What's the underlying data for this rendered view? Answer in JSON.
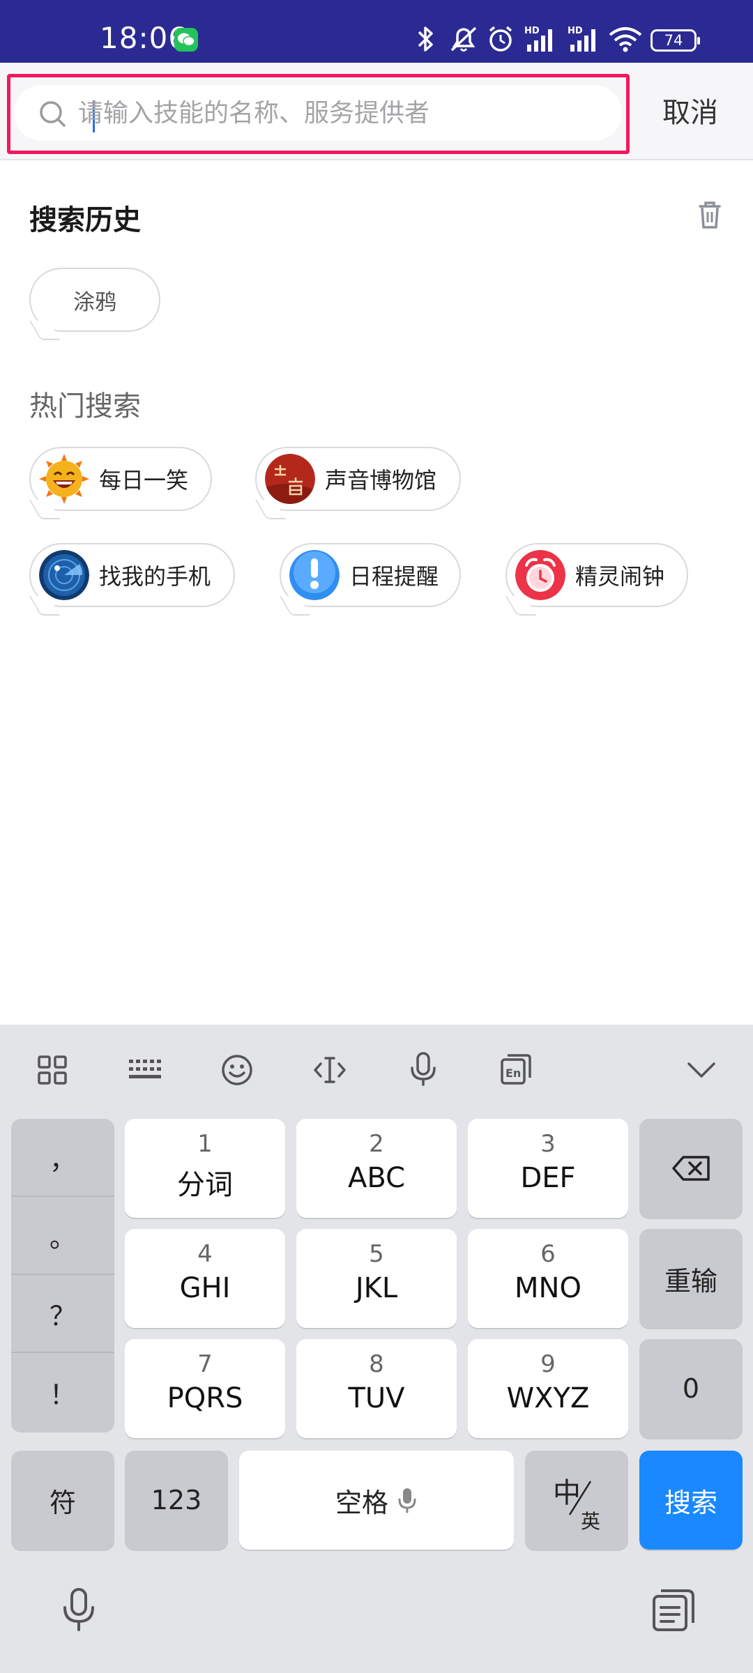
{
  "status_bar": {
    "time": "18:06",
    "battery": "74",
    "icons": [
      "wechat-icon",
      "bluetooth-icon",
      "mute-icon",
      "alarm-icon",
      "signal-hd-icon",
      "signal-hd-icon",
      "wifi-icon",
      "battery-icon"
    ]
  },
  "search": {
    "placeholder": "请输入技能的名称、服务提供者",
    "value": "",
    "cancel_label": "取消",
    "highlight_color": "#f0195f"
  },
  "history": {
    "title": "搜索历史",
    "items": [
      "涂鸦"
    ]
  },
  "hot": {
    "title": "热门搜索",
    "items": [
      {
        "label": "每日一笑",
        "icon": "laughing-sun-icon"
      },
      {
        "label": "声音博物馆",
        "icon": "sound-museum-icon"
      },
      {
        "label": "找我的手机",
        "icon": "radar-icon"
      },
      {
        "label": "日程提醒",
        "icon": "exclamation-icon"
      },
      {
        "label": "精灵闹钟",
        "icon": "alarm-clock-icon"
      }
    ]
  },
  "keyboard": {
    "toolbar": [
      "grid-icon",
      "keyboard-icon",
      "emoji-icon",
      "cursor-icon",
      "mic-icon",
      "translate-icon",
      "collapse-icon"
    ],
    "punctuation": [
      "，",
      "。",
      "？",
      "！"
    ],
    "keys": [
      {
        "num": "1",
        "letters": "分词"
      },
      {
        "num": "2",
        "letters": "ABC"
      },
      {
        "num": "3",
        "letters": "DEF"
      },
      {
        "num": "4",
        "letters": "GHI"
      },
      {
        "num": "5",
        "letters": "JKL"
      },
      {
        "num": "6",
        "letters": "MNO"
      },
      {
        "num": "7",
        "letters": "PQRS"
      },
      {
        "num": "8",
        "letters": "TUV"
      },
      {
        "num": "9",
        "letters": "WXYZ"
      }
    ],
    "reinput": "重输",
    "zero": "0",
    "symbols": "符",
    "num_mode": "123",
    "space": "空格",
    "lang_top": "中",
    "lang_bottom": "英",
    "search": "搜索",
    "accent": "#1a88ff"
  }
}
